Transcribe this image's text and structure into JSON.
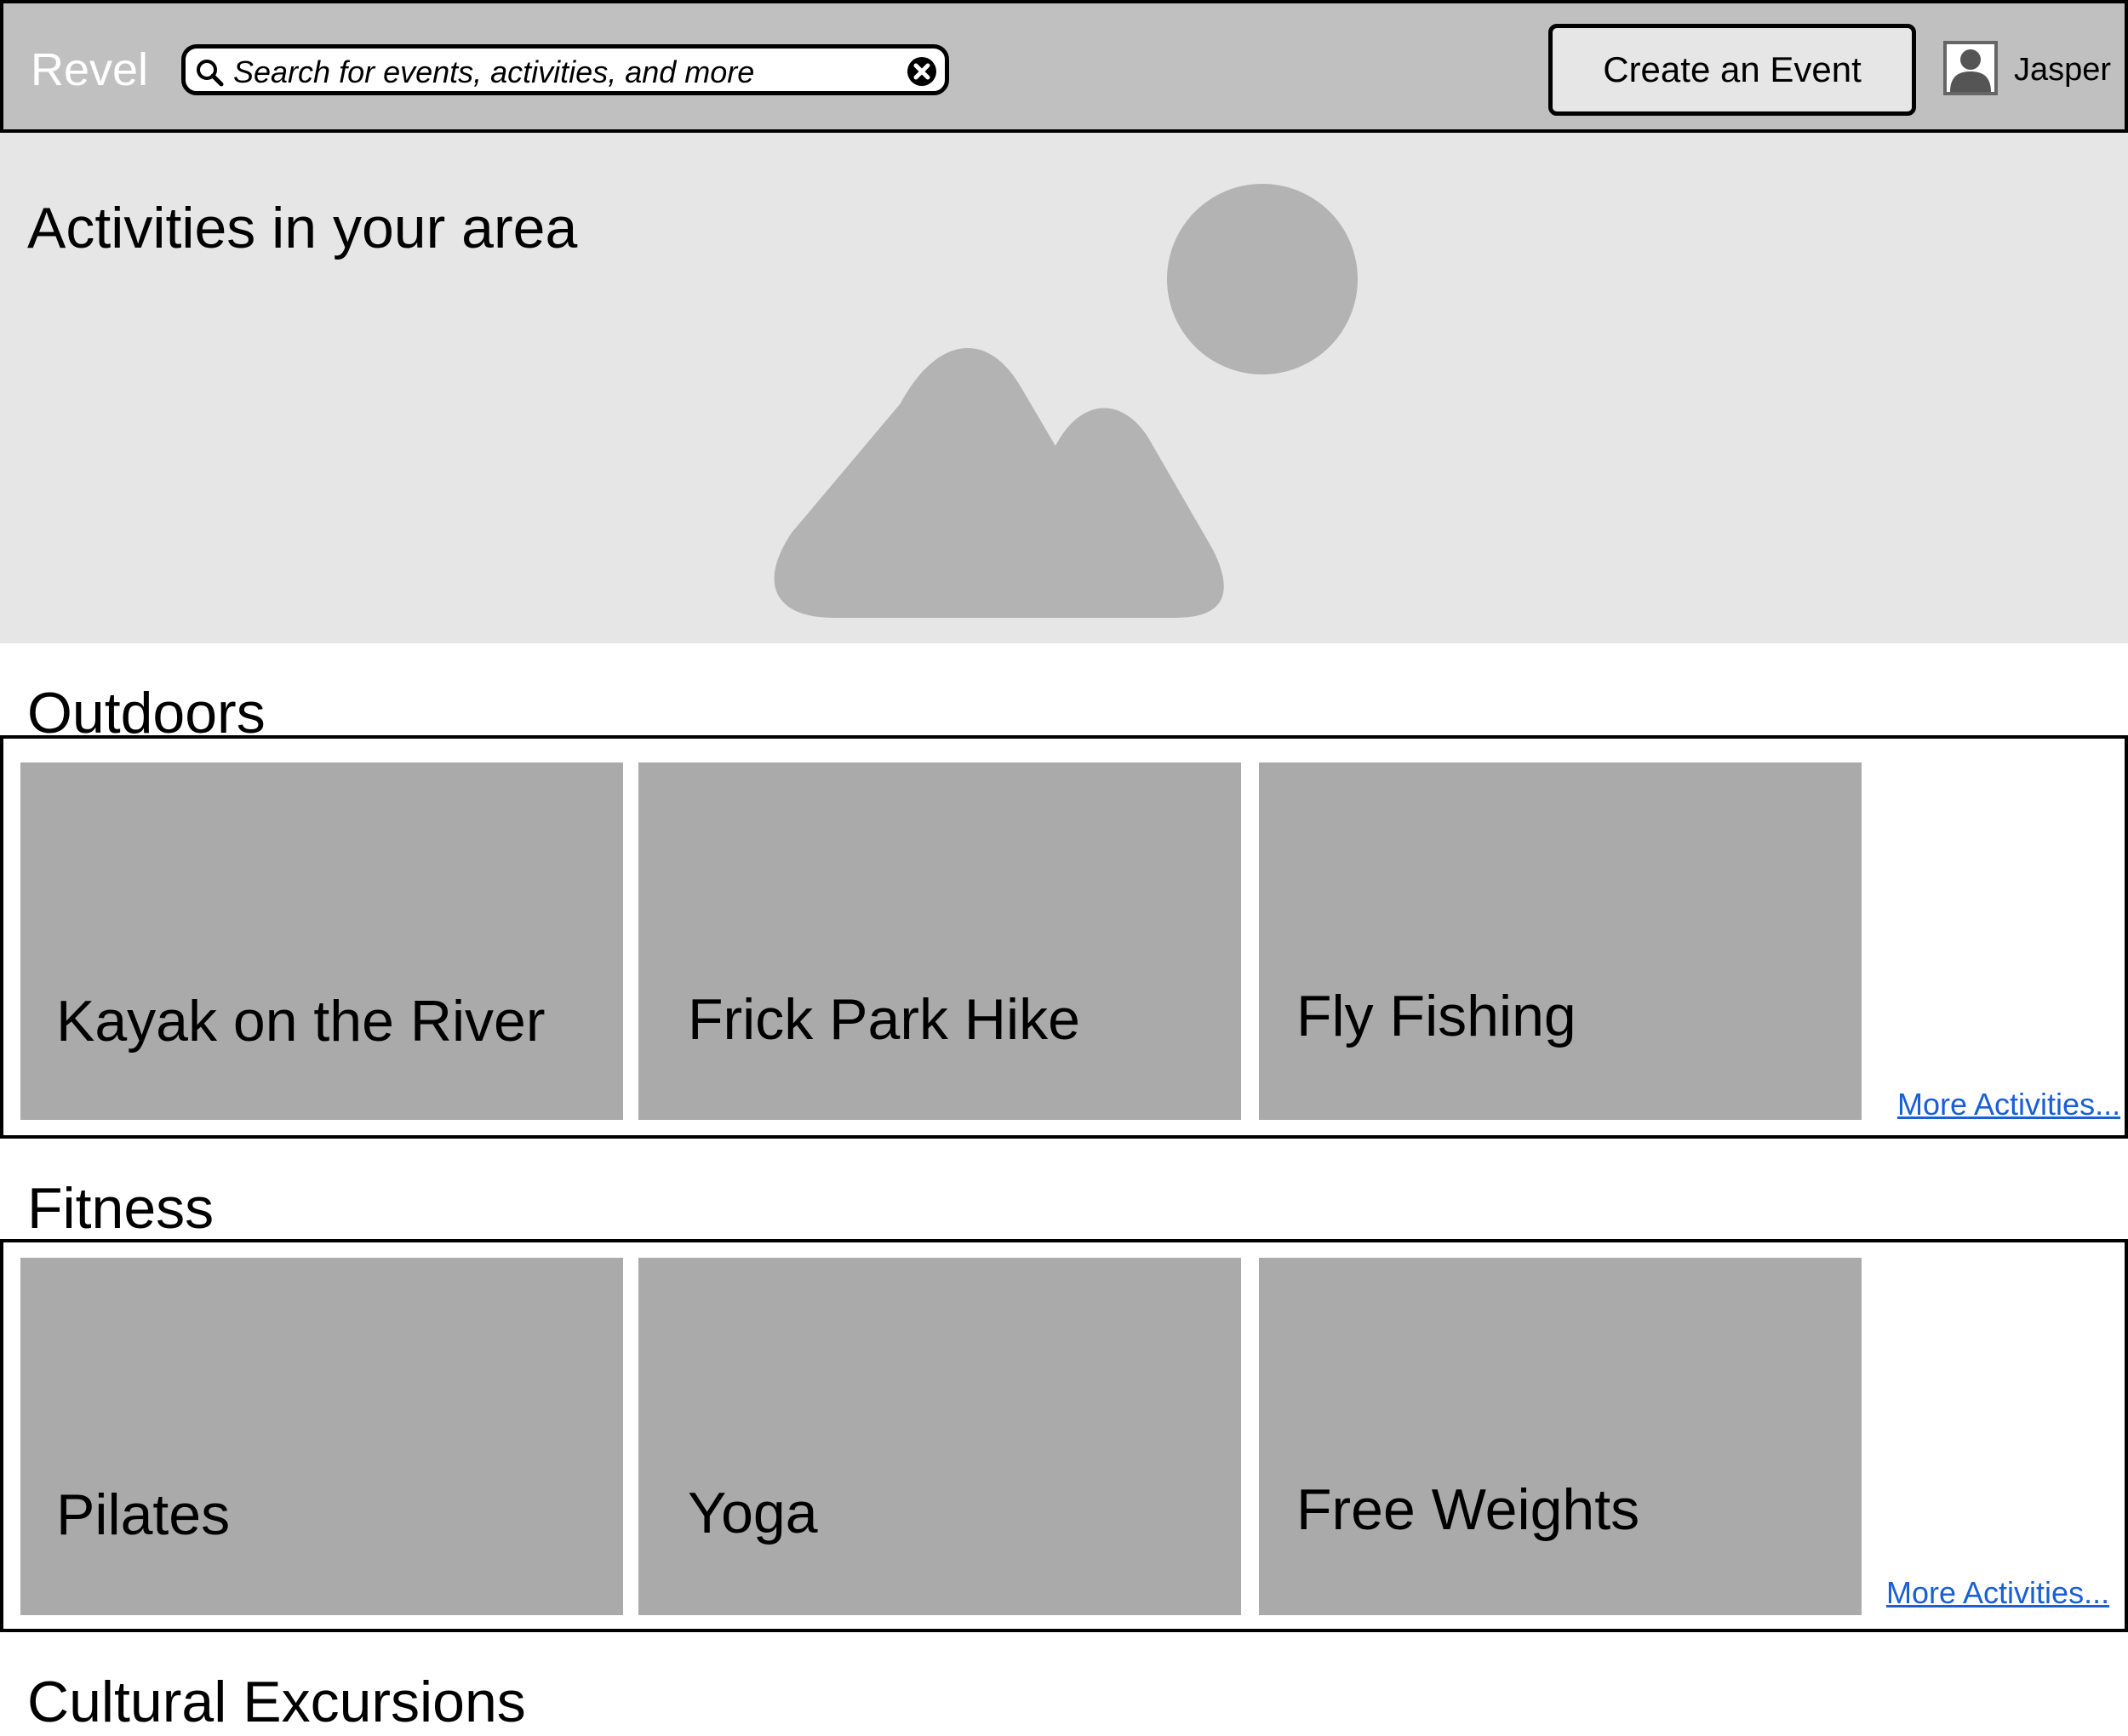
{
  "header": {
    "brand": "Revel",
    "search": {
      "placeholder": "Search for events, activities, and more"
    },
    "create_event_label": "Create an Event",
    "user": {
      "name": "Jasper",
      "avatar_icon": "user-avatar-icon"
    }
  },
  "hero": {
    "title": "Activities in your area",
    "image_icon": "image-placeholder-icon"
  },
  "sections": [
    {
      "title": "Outdoors",
      "cards": [
        {
          "label": "Kayak on the River"
        },
        {
          "label": "Frick Park Hike"
        },
        {
          "label": "Fly Fishing"
        }
      ],
      "more_link": "More Activities..."
    },
    {
      "title": "Fitness",
      "cards": [
        {
          "label": "Pilates"
        },
        {
          "label": "Yoga"
        },
        {
          "label": "Free Weights"
        }
      ],
      "more_link": "More Activities..."
    },
    {
      "title": "Cultural Excursions"
    }
  ],
  "colors": {
    "header_bg": "#c0c0c0",
    "hero_bg": "#e6e6e6",
    "card_bg": "#aaaaaa",
    "link": "#1a5fd6"
  }
}
